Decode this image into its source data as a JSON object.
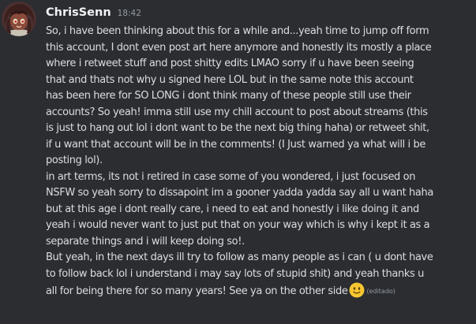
{
  "message": {
    "author": "ChrisSenn",
    "timestamp": "18:42",
    "lines": [
      "So, i have been thinking about this for a while and...yeah time to jump off form",
      "this account, I dont even post art here anymore and honestly its mostly a place",
      "where i retweet stuff and post shitty edits LMAO sorry if u have been seeing",
      "that and thats not why u signed here LOL but in the same note this account",
      "has been here for SO LONG i dont think many of these people still use their",
      "accounts? So yeah! imma still use my chill account to post about streams (this",
      "is just to hang out lol i dont want to be the next big thing haha)  or retweet shit,",
      "if u want that account will be in the comments! (I Just warned ya what will i be",
      "posting lol).",
      "in art terms, its not i retired in case some of you wondered, i just focused on",
      "NSFW so yeah sorry to dissapoint im a gooner yadda yadda say all u want haha",
      "but at this age i dont really care, i need to eat and honestly i like doing it and",
      "yeah i would never want to just put that on your way which is why i kept it as a",
      "separate things and i will keep doing so!.",
      "But yeah, in the next days ill try to follow as many people as i can ( u dont have",
      "to follow back lol i understand i may say lots of stupid shit) and yeah thanks u",
      "all for being there for so many years! See ya on the other side"
    ],
    "emoji": "slightly-smiling-face",
    "edited_label": "(editado)"
  },
  "colors": {
    "background": "#2b2d31",
    "username": "#f2f3f5",
    "text": "#dbdee1",
    "muted": "#949ba4",
    "emoji": "#f7c531"
  }
}
